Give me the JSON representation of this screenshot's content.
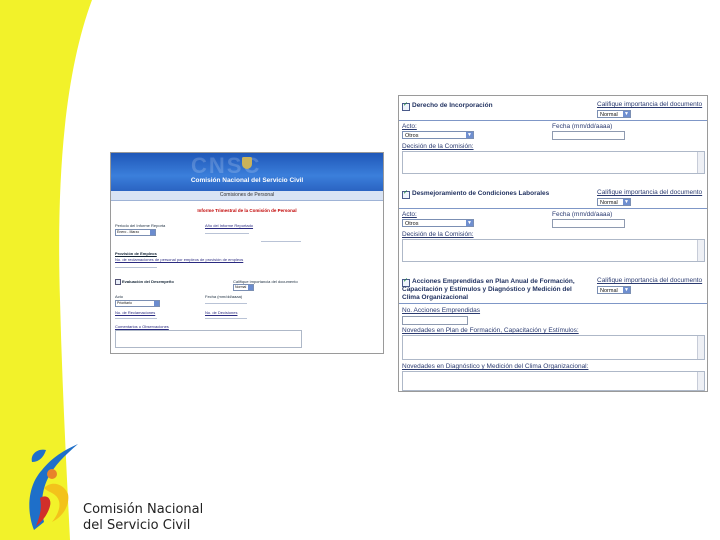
{
  "colors": {
    "swoosh": "#f2f22a",
    "header_blue": "#2a63c2"
  },
  "left_screenshot": {
    "watermark": "CNSC",
    "title": "Comisión Nacional del Servicio Civil",
    "subtitle": "Comisiones de Personal",
    "report_title": "Informe Trimestral de la Comisión de Personal",
    "f1_label": "Periodo del Informe Reporta",
    "f1_value": "Enero - Marzo",
    "f2_label": "Año del Informe Reportado",
    "section_quejas": "Provisión de Empleos",
    "quejas_text": "No. de reclamaciones de personal por empleos de provisión de empleos",
    "section_eval": "Evaluación del Desempeño",
    "calif_label": "Califique importancia del documento",
    "calif_value": "Normal",
    "acto_label": "Acto",
    "acto_value": "Prioritario",
    "fecha_label": "Fecha (mm/dd/aaaa)",
    "no_reclam_label": "No. de Reclamaciones",
    "no_decisiones_label": "No. de Decisiones",
    "comentarios_label": "Comentarios u Observaciones"
  },
  "right_screenshot": {
    "sec1": {
      "title": "Derecho de Incorporación",
      "calif_label": "Califique importancia del documento",
      "calif_value": "Normal",
      "acto_label": "Acto:",
      "acto_value": "Otros",
      "fecha_label": "Fecha (mm/dd/aaaa)",
      "decision_label": "Decisión de la Comisión:"
    },
    "sec2": {
      "title": "Desmejoramiento de Condiciones Laborales",
      "calif_label": "Califique importancia del documento",
      "calif_value": "Normal",
      "acto_label": "Acto:",
      "acto_value": "Otros",
      "fecha_label": "Fecha (mm/dd/aaaa)",
      "decision_label": "Decisión de la Comisión:"
    },
    "sec3": {
      "title_l1": "Acciones Emprendidas en Plan Anual de Formación,",
      "title_l2": "Capacitación y Estímulos y Diagnóstico y Medición del",
      "title_l3": "Clima Organizacional",
      "calif_label": "Califique importancia del documento",
      "calif_value": "Normal",
      "no_acciones_label": "No. Acciones Emprendidas",
      "novedades1_label": "Novedades en Plan de Formación, Capacitación y Estímulos:",
      "novedades2_label": "Novedades en Diagnóstico y Medición del Clima Organizacional:"
    }
  },
  "logo": {
    "line1": "Comisión Nacional",
    "line2": "del Servicio Civil"
  }
}
